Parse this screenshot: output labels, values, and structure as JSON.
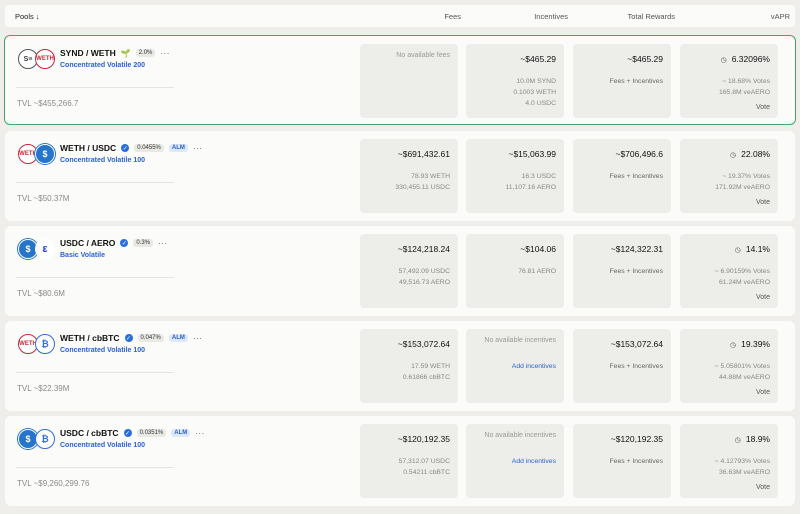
{
  "header": {
    "pools": "Pools ↓",
    "fees": "Fees",
    "incentives": "Incentives",
    "total_rewards": "Total Rewards",
    "vapr": "vAPR"
  },
  "rows": [
    {
      "pair": "SYND / WETH",
      "fee": "2.0%",
      "type": "Concentrated Volatile 200",
      "tvl": "TVL ~$455,266.7",
      "fees_total": "No available fees",
      "inc_total": "~$465.29",
      "inc_line1": "10.0M SYND",
      "inc_line2": "0.1003 WETH",
      "inc_line3": "4.0 USDC",
      "rewards_total": "~$465.29",
      "rewards_label": "Fees + Incentives",
      "vapr": "6.32096%",
      "votes": "~ 18.68% Votes",
      "veaero": "165.8M veAERO",
      "vote": "Vote"
    },
    {
      "pair": "WETH / USDC",
      "fee": "0.0455%",
      "alm": "ALM",
      "type": "Concentrated Volatile 100",
      "tvl": "TVL ~$50.37M",
      "fees_total": "~$691,432.61",
      "fees_line1": "78.93 WETH",
      "fees_line2": "330,455.11 USDC",
      "inc_total": "~$15,063.99",
      "inc_line1": "16.3 USDC",
      "inc_line2": "11,107.16 AERO",
      "rewards_total": "~$706,496.6",
      "rewards_label": "Fees + Incentives",
      "vapr": "22.08%",
      "votes": "~ 19.37% Votes",
      "veaero": "171.92M veAERO",
      "vote": "Vote"
    },
    {
      "pair": "USDC / AERO",
      "fee": "0.3%",
      "type": "Basic Volatile",
      "tvl": "TVL ~$80.6M",
      "fees_total": "~$124,218.24",
      "fees_line1": "57,492.09 USDC",
      "fees_line2": "49,516.73 AERO",
      "inc_total": "~$104.06",
      "inc_line1": "76.81 AERO",
      "rewards_total": "~$124,322.31",
      "rewards_label": "Fees + Incentives",
      "vapr": "14.1%",
      "votes": "~ 6.90159% Votes",
      "veaero": "61.24M veAERO",
      "vote": "Vote"
    },
    {
      "pair": "WETH / cbBTC",
      "fee": "0.047%",
      "alm": "ALM",
      "type": "Concentrated Volatile 100",
      "tvl": "TVL ~$22.39M",
      "fees_total": "~$153,072.64",
      "fees_line1": "17.59 WETH",
      "fees_line2": "0.61866 cbBTC",
      "inc_total": "No available incentives",
      "inc_link": "Add incentives",
      "rewards_total": "~$153,072.64",
      "rewards_label": "Fees + Incentives",
      "vapr": "19.39%",
      "votes": "~ 5.05801% Votes",
      "veaero": "44.88M veAERO",
      "vote": "Vote"
    },
    {
      "pair": "USDC / cbBTC",
      "fee": "0.0351%",
      "alm": "ALM",
      "type": "Concentrated Volatile 100",
      "tvl": "TVL ~$9,260,299.76",
      "fees_total": "~$120,192.35",
      "fees_line1": "57,312.07 USDC",
      "fees_line2": "0.54211 cbBTC",
      "inc_total": "No available incentives",
      "inc_link": "Add incentives",
      "rewards_total": "~$120,192.35",
      "rewards_label": "Fees + Incentives",
      "vapr": "18.9%",
      "votes": "~ 4.12793% Votes",
      "veaero": "36.63M veAERO",
      "vote": "Vote"
    }
  ],
  "token_glyphs": {
    "synd": "S≡",
    "weth": "WETH",
    "usdc": "$",
    "aero": "ε",
    "btc": "₿"
  }
}
